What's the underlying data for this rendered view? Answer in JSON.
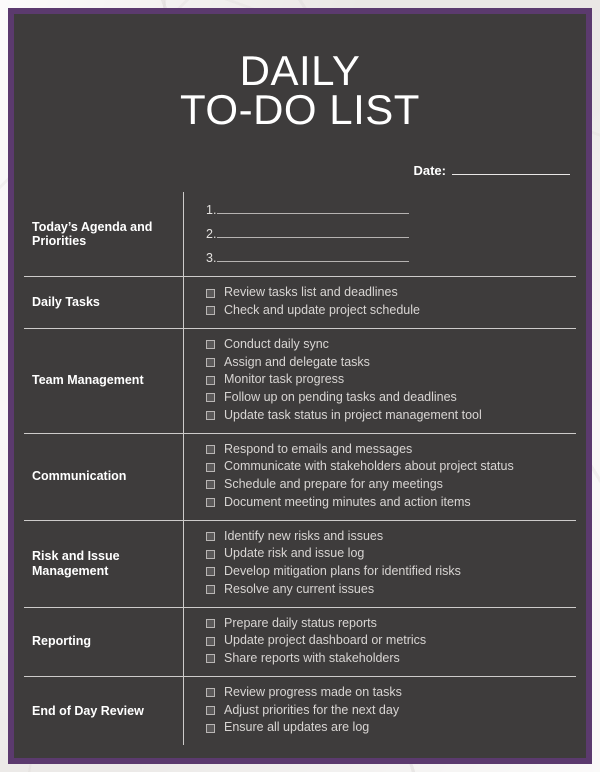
{
  "theme": {
    "frame_color": "#5b3a6e",
    "card_color": "#3e3c3c",
    "rule_color": "#cdcbca",
    "text_color": "#d8d5d3",
    "heading_color": "#ffffff"
  },
  "title": {
    "line1": "DAILY",
    "line2": "TO-DO LIST"
  },
  "date": {
    "label": "Date",
    "colon": ":",
    "value": ""
  },
  "rows": [
    {
      "label": "Today’s Agenda and Priorities",
      "type": "numbered",
      "items": [
        {
          "number": "1."
        },
        {
          "number": "2."
        },
        {
          "number": "3."
        }
      ]
    },
    {
      "label": "Daily Tasks",
      "type": "checklist",
      "items": [
        "Review tasks list and deadlines",
        "Check and update project schedule"
      ]
    },
    {
      "label": "Team Management",
      "type": "checklist",
      "items": [
        "Conduct daily sync",
        "Assign and delegate tasks",
        "Monitor task progress",
        "Follow up on pending tasks and deadlines",
        "Update task status in project management tool"
      ]
    },
    {
      "label": "Communication",
      "type": "checklist",
      "items": [
        "Respond to emails and messages",
        "Communicate with stakeholders about project status",
        "Schedule and prepare for any meetings",
        "Document meeting minutes and action items"
      ]
    },
    {
      "label": "Risk and Issue Management",
      "type": "checklist",
      "items": [
        "Identify new risks and issues",
        "Update risk and issue log",
        "Develop mitigation plans for identified risks",
        "Resolve any current issues"
      ]
    },
    {
      "label": "Reporting",
      "type": "checklist",
      "items": [
        "Prepare daily status reports",
        "Update project dashboard or metrics",
        "Share reports with stakeholders"
      ]
    },
    {
      "label": "End of Day Review",
      "type": "checklist",
      "items": [
        "Review progress made on tasks",
        "Adjust priorities for the next day",
        "Ensure all updates are log"
      ]
    }
  ]
}
